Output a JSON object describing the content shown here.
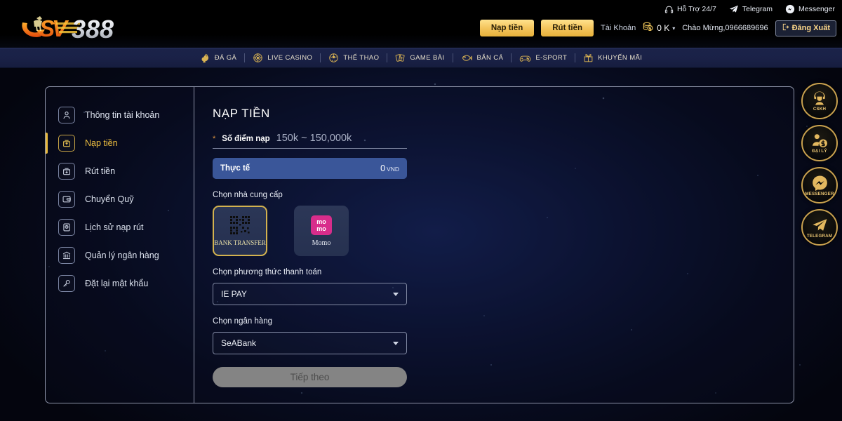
{
  "brand": {
    "name": "SV388"
  },
  "header": {
    "utilities": [
      {
        "label": "Hỗ Trợ 24/7",
        "icon": "headset-icon"
      },
      {
        "label": "Telegram",
        "icon": "telegram-icon"
      },
      {
        "label": "Messenger",
        "icon": "messenger-icon"
      }
    ],
    "deposit_label": "Nạp tiền",
    "withdraw_label": "Rút tiền",
    "account_label": "Tài Khoản",
    "balance": "0 K",
    "welcome": "Chào Mừng,0966689696",
    "logout_label": "Đăng Xuất"
  },
  "nav": {
    "items": [
      {
        "label": "ĐÁ GÀ",
        "icon": "rooster-icon"
      },
      {
        "label": "LIVE CASINO",
        "icon": "chip-icon"
      },
      {
        "label": "THỂ THAO",
        "icon": "football-icon"
      },
      {
        "label": "GAME BÀI",
        "icon": "cards-icon"
      },
      {
        "label": "BẮN CÁ",
        "icon": "fish-icon"
      },
      {
        "label": "E-SPORT",
        "icon": "gamepad-icon"
      },
      {
        "label": "KHUYẾN MÃI",
        "icon": "gift-icon"
      }
    ]
  },
  "sidebar": {
    "items": [
      {
        "label": "Thông tin tài khoản",
        "icon": "user-icon",
        "active": false
      },
      {
        "label": "Nạp tiền",
        "icon": "deposit-icon",
        "active": true
      },
      {
        "label": "Rút tiền",
        "icon": "withdraw-icon",
        "active": false
      },
      {
        "label": "Chuyển Quỹ",
        "icon": "wallet-icon",
        "active": false
      },
      {
        "label": "Lịch sử nạp rút",
        "icon": "history-icon",
        "active": false
      },
      {
        "label": "Quản lý ngân hàng",
        "icon": "bank-icon",
        "active": false
      },
      {
        "label": "Đặt lại mật khẩu",
        "icon": "key-icon",
        "active": false
      }
    ]
  },
  "main": {
    "title": "NẠP TIỀN",
    "amount_field": {
      "required_mark": "*",
      "label": "Số điểm nạp",
      "value": "",
      "placeholder": "150k ~ 150,000k"
    },
    "actual": {
      "label": "Thực tế",
      "value": "0",
      "unit": "VND"
    },
    "provider_section_label": "Chọn nhà cung cấp",
    "providers": [
      {
        "label": "BANK TRANSFER",
        "icon": "qr-code-icon",
        "selected": true
      },
      {
        "label": "Momo",
        "icon": "momo-logo-icon",
        "selected": false
      }
    ],
    "payment_method_label": "Chọn phương thức thanh toán",
    "payment_method_value": "IE PAY",
    "bank_label": "Chọn ngân hàng",
    "bank_value": "SeABank",
    "next_button": "Tiếp theo"
  },
  "dock": {
    "items": [
      {
        "label": "CSKH",
        "icon": "support-agent-icon"
      },
      {
        "label": "ĐẠI LÝ",
        "icon": "agent-money-icon"
      },
      {
        "label": "MESSENGER",
        "icon": "messenger-icon"
      },
      {
        "label": "TELEGRAM",
        "icon": "telegram-icon"
      }
    ]
  },
  "colors": {
    "gold": "#e7c271",
    "accent_gold": "#f3c45b",
    "panel_blue": "#3a5699",
    "momo_pink": "#d82d8b"
  }
}
